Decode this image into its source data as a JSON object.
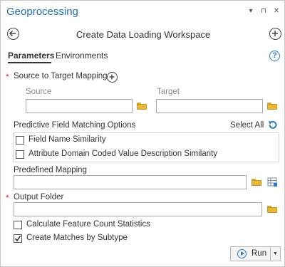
{
  "window": {
    "title": "Geoprocessing",
    "controls": {
      "dropdown": "▾",
      "pin": "⊓",
      "close": "✕"
    }
  },
  "header": {
    "tool_title": "Create Data Loading Workspace",
    "back_icon": "back-arrow-icon",
    "add_icon": "plus-icon"
  },
  "tabs": [
    {
      "label": "Parameters",
      "active": true
    },
    {
      "label": "Environments",
      "active": false
    }
  ],
  "help_label": "?",
  "source_target": {
    "label": "Source to Target Mapping",
    "required": true,
    "source_label": "Source",
    "target_label": "Target",
    "source_value": "",
    "target_value": ""
  },
  "field_matching": {
    "label": "Predictive Field Matching Options",
    "select_all": "Select All",
    "options": [
      {
        "label": "Field Name Similarity",
        "checked": false
      },
      {
        "label": "Attribute Domain Coded Value Description Similarity",
        "checked": false
      }
    ]
  },
  "predefined_mapping": {
    "label": "Predefined Mapping",
    "value": ""
  },
  "output_folder": {
    "label": "Output Folder",
    "required": true,
    "value": ""
  },
  "checkboxes": [
    {
      "label": "Calculate Feature Count Statistics",
      "checked": false
    },
    {
      "label": "Create Matches by Subtype",
      "checked": true
    }
  ],
  "run": {
    "label": "Run"
  },
  "colors": {
    "accent": "#2b7bc4",
    "title": "#1f6fb2",
    "required": "#dd2222",
    "folder": "#e9b73a"
  }
}
